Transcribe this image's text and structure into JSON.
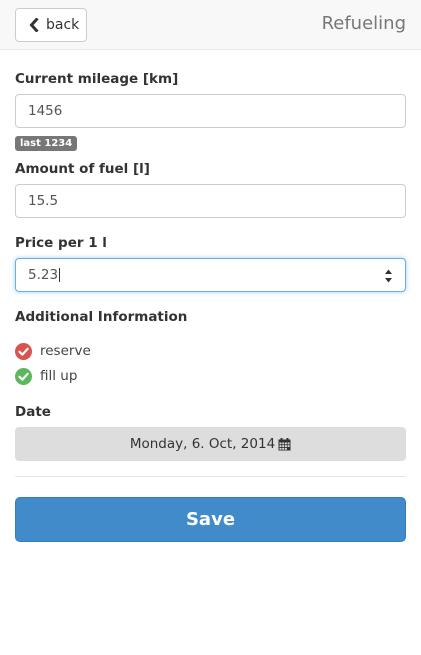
{
  "header": {
    "back_label": "back",
    "title": "Refueling"
  },
  "form": {
    "mileage": {
      "label": "Current mileage [km]",
      "value": "1456",
      "badge": "last 1234"
    },
    "fuel": {
      "label": "Amount of fuel [l]",
      "value": "15.5"
    },
    "price": {
      "label": "Price per 1 l",
      "value": "5.23"
    },
    "additional": {
      "label": "Additional Information",
      "options": [
        {
          "label": "reserve",
          "color": "#d9534f"
        },
        {
          "label": "fill up",
          "color": "#5cb85c"
        }
      ]
    },
    "date": {
      "label": "Date",
      "value": "Monday, 6. Oct, 2014"
    },
    "save_label": "Save"
  },
  "colors": {
    "primary": "#428bca",
    "danger": "#d9534f",
    "success": "#5cb85c"
  }
}
